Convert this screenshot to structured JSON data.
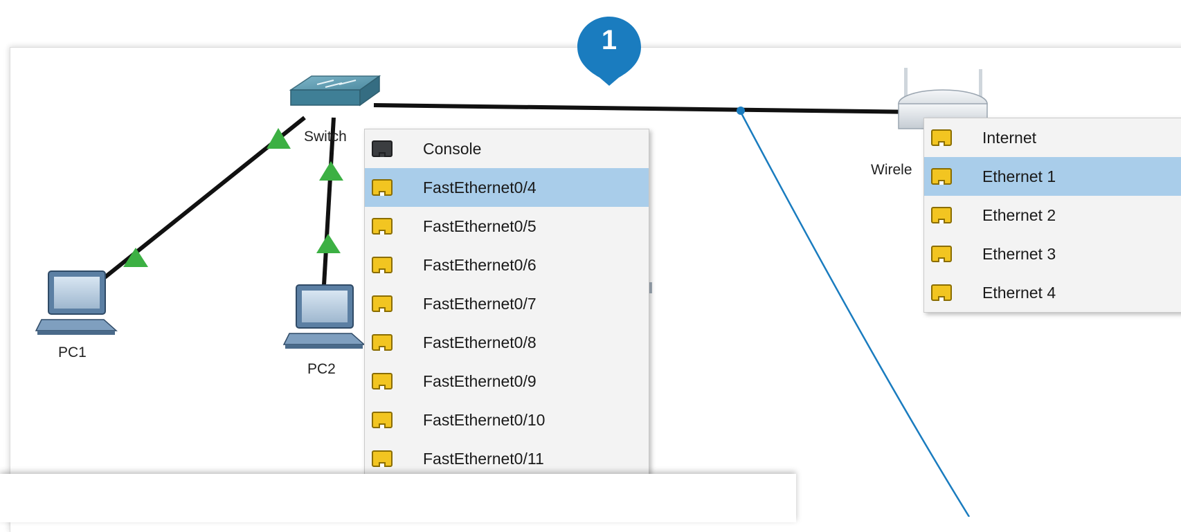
{
  "marker": {
    "number": "1",
    "color": "#1a7cbf"
  },
  "devices": {
    "switch": {
      "label": "Switch"
    },
    "pc1": {
      "label": "PC1"
    },
    "pc2": {
      "label": "PC2"
    },
    "router": {
      "label": "Wirele"
    }
  },
  "switch_port_menu": {
    "items": [
      {
        "label": "Console",
        "icon": "console-port-icon",
        "selected": false
      },
      {
        "label": "FastEthernet0/4",
        "icon": "ethernet-port-icon",
        "selected": true
      },
      {
        "label": "FastEthernet0/5",
        "icon": "ethernet-port-icon",
        "selected": false
      },
      {
        "label": "FastEthernet0/6",
        "icon": "ethernet-port-icon",
        "selected": false
      },
      {
        "label": "FastEthernet0/7",
        "icon": "ethernet-port-icon",
        "selected": false
      },
      {
        "label": "FastEthernet0/8",
        "icon": "ethernet-port-icon",
        "selected": false
      },
      {
        "label": "FastEthernet0/9",
        "icon": "ethernet-port-icon",
        "selected": false
      },
      {
        "label": "FastEthernet0/10",
        "icon": "ethernet-port-icon",
        "selected": false
      },
      {
        "label": "FastEthernet0/11",
        "icon": "ethernet-port-icon",
        "selected": false
      }
    ]
  },
  "router_port_menu": {
    "items": [
      {
        "label": "Internet",
        "icon": "ethernet-port-icon",
        "selected": false
      },
      {
        "label": "Ethernet 1",
        "icon": "ethernet-port-icon",
        "selected": true
      },
      {
        "label": "Ethernet 2",
        "icon": "ethernet-port-icon",
        "selected": false
      },
      {
        "label": "Ethernet 3",
        "icon": "ethernet-port-icon",
        "selected": false
      },
      {
        "label": "Ethernet 4",
        "icon": "ethernet-port-icon",
        "selected": false
      }
    ]
  },
  "colors": {
    "selection": "#a9cdea",
    "link_up": "#3cb043",
    "cable_in_progress": "#1a7cbf",
    "ethernet_port": "#f2c521"
  }
}
